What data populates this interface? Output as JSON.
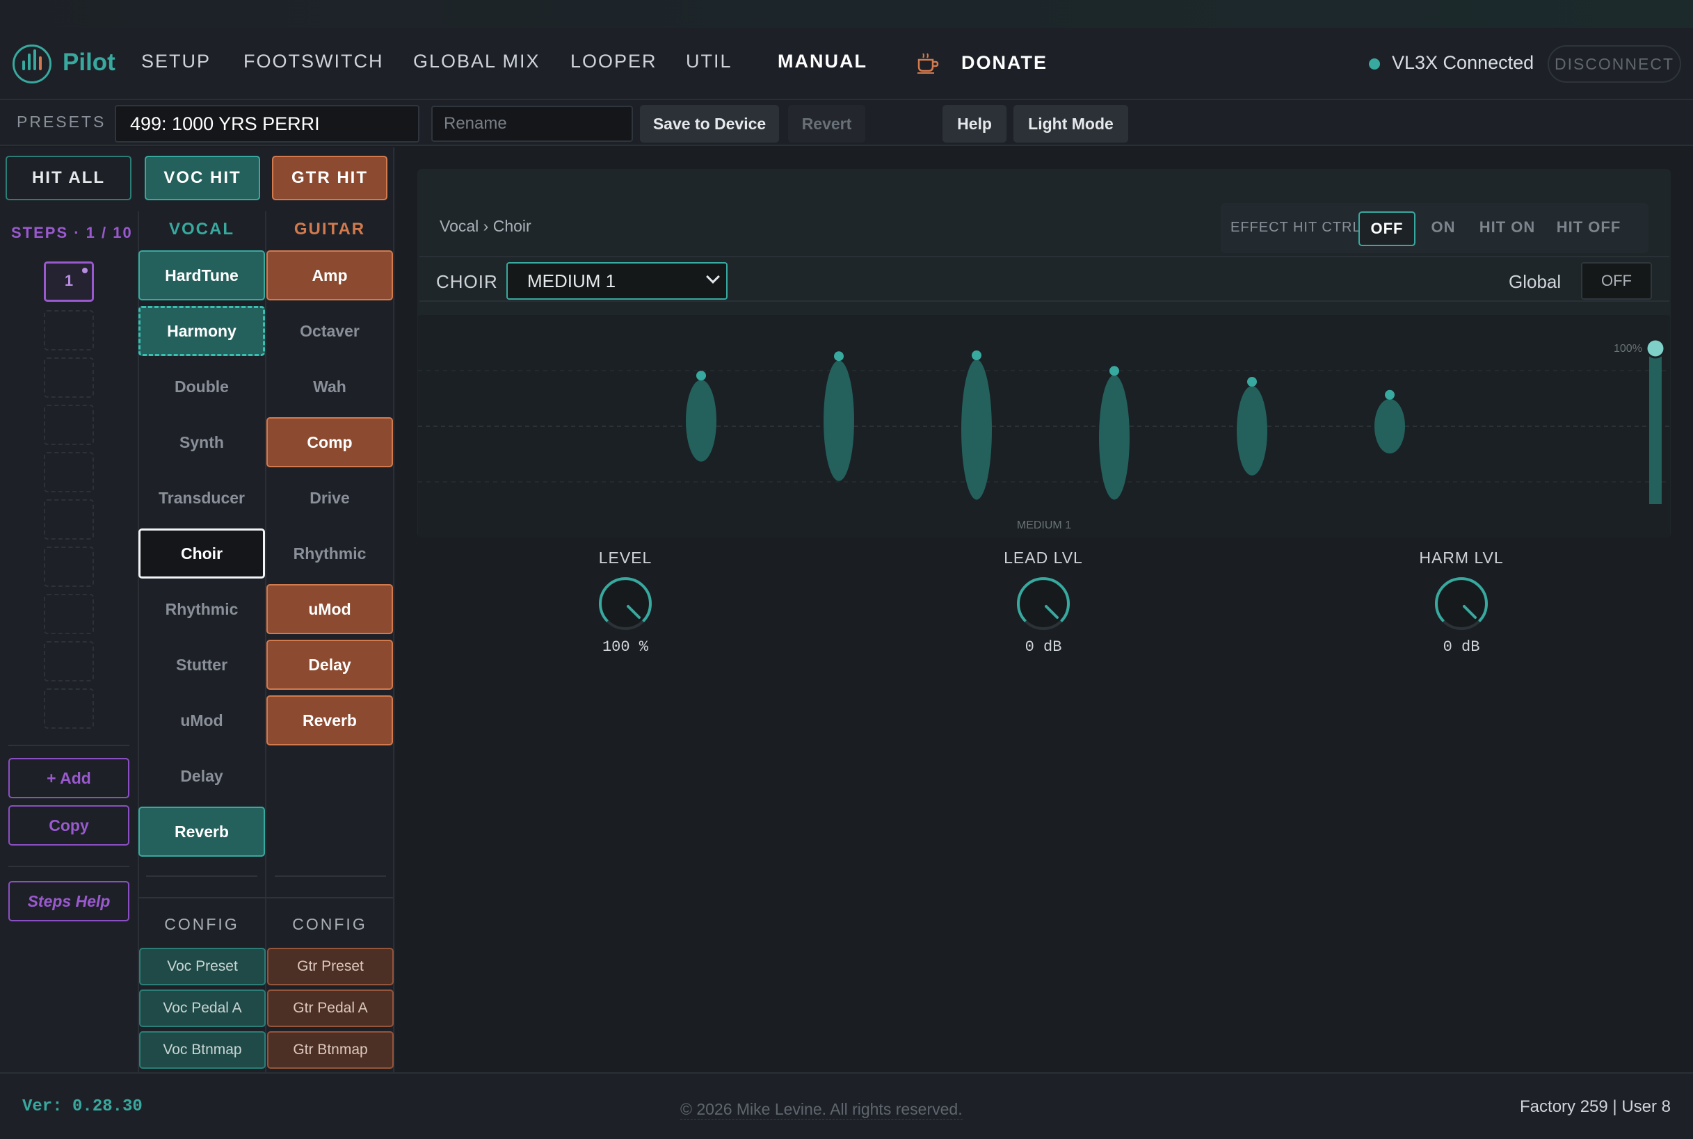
{
  "nav": {
    "brand": "Pilot",
    "items": [
      "SETUP",
      "FOOTSWITCH",
      "GLOBAL MIX",
      "LOOPER",
      "UTIL",
      "MANUAL"
    ],
    "donate": "DONATE",
    "status": "VL3X Connected",
    "disconnect": "DISCONNECT"
  },
  "presets": {
    "label": "PRESETS",
    "current": "499: 1000 YRS PERRI",
    "rename_placeholder": "Rename",
    "save": "Save to Device",
    "revert": "Revert",
    "help": "Help",
    "light_mode": "Light Mode"
  },
  "hits": {
    "all": "HIT ALL",
    "voc": "VOC HIT",
    "gtr": "GTR HIT"
  },
  "steps": {
    "label": "STEPS · 1 / 10",
    "current": "1",
    "add": "+ Add",
    "copy": "Copy",
    "help": "Steps Help"
  },
  "vocal": {
    "title": "VOCAL",
    "effects": [
      {
        "label": "HardTune",
        "state": "on"
      },
      {
        "label": "Harmony",
        "state": "harm"
      },
      {
        "label": "Double",
        "state": "off"
      },
      {
        "label": "Synth",
        "state": "off"
      },
      {
        "label": "Transducer",
        "state": "off"
      },
      {
        "label": "Choir",
        "state": "selected"
      },
      {
        "label": "Rhythmic",
        "state": "off"
      },
      {
        "label": "Stutter",
        "state": "off"
      },
      {
        "label": "uMod",
        "state": "off"
      },
      {
        "label": "Delay",
        "state": "off"
      },
      {
        "label": "Reverb",
        "state": "on"
      }
    ],
    "config_label": "CONFIG",
    "config": [
      "Voc Preset",
      "Voc Pedal A",
      "Voc Btnmap"
    ]
  },
  "guitar": {
    "title": "GUITAR",
    "effects": [
      {
        "label": "Amp",
        "state": "on"
      },
      {
        "label": "Octaver",
        "state": "off"
      },
      {
        "label": "Wah",
        "state": "off"
      },
      {
        "label": "Comp",
        "state": "on"
      },
      {
        "label": "Drive",
        "state": "off"
      },
      {
        "label": "Rhythmic",
        "state": "off"
      },
      {
        "label": "uMod",
        "state": "on"
      },
      {
        "label": "Delay",
        "state": "on"
      },
      {
        "label": "Reverb",
        "state": "on"
      }
    ],
    "config_label": "CONFIG",
    "config": [
      "Gtr Preset",
      "Gtr Pedal A",
      "Gtr Btnmap"
    ]
  },
  "editor": {
    "breadcrumb": "Vocal › Choir",
    "hit_ctrl": {
      "label": "EFFECT HIT CTRL:",
      "options": [
        "OFF",
        "ON",
        "HIT ON",
        "HIT OFF"
      ],
      "selected": "OFF"
    },
    "choir_label": "CHOIR",
    "choir_value": "MEDIUM 1",
    "global_label": "Global",
    "global_value": "OFF",
    "viz_caption": "MEDIUM 1",
    "level_marker": "100%",
    "level_fraction": 1.0,
    "voices": [
      {
        "height": 0.42,
        "offset": -0.05
      },
      {
        "height": 0.62,
        "offset": -0.05
      },
      {
        "height": 0.72,
        "offset": 0.03
      },
      {
        "height": 0.64,
        "offset": 0.1
      },
      {
        "height": 0.46,
        "offset": 0.04
      },
      {
        "height": 0.28,
        "offset": 0.0
      }
    ],
    "knobs": [
      {
        "label": "LEVEL",
        "value": "100 %"
      },
      {
        "label": "LEAD LVL",
        "value": "0 dB"
      },
      {
        "label": "HARM LVL",
        "value": "0 dB"
      }
    ]
  },
  "footer": {
    "version": "Ver: 0.28.30",
    "copyright": "© 2026 Mike Levine. All rights reserved.",
    "counts": "Factory 259 | User 8"
  },
  "colors": {
    "accent": "#38a99f",
    "guitar": "#d27a4e",
    "steps": "#9b59d0"
  }
}
